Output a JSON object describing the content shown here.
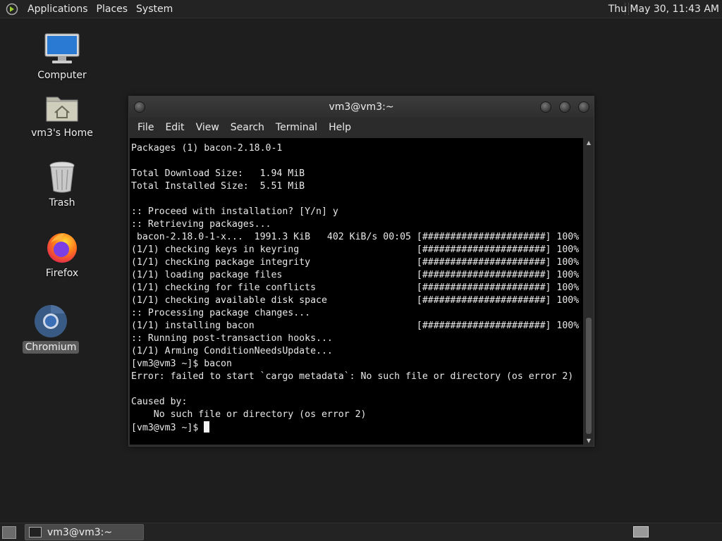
{
  "top_panel": {
    "menus": [
      "Applications",
      "Places",
      "System"
    ],
    "clock": "Thu May 30, 11:43 AM"
  },
  "desktop": {
    "icons": [
      {
        "label": "Computer",
        "icon": "computer-icon"
      },
      {
        "label": "vm3's Home",
        "icon": "home-folder-icon"
      },
      {
        "label": "Trash",
        "icon": "trash-icon"
      },
      {
        "label": "Firefox",
        "icon": "firefox-icon"
      },
      {
        "label": "Chromium",
        "icon": "chromium-icon"
      }
    ]
  },
  "terminal": {
    "title": "vm3@vm3:~",
    "menu": [
      "File",
      "Edit",
      "View",
      "Search",
      "Terminal",
      "Help"
    ],
    "lines": [
      "Packages (1) bacon-2.18.0-1",
      "",
      "Total Download Size:   1.94 MiB",
      "Total Installed Size:  5.51 MiB",
      "",
      ":: Proceed with installation? [Y/n] y",
      ":: Retrieving packages...",
      " bacon-2.18.0-1-x...  1991.3 KiB   402 KiB/s 00:05 [######################] 100%",
      "(1/1) checking keys in keyring                     [######################] 100%",
      "(1/1) checking package integrity                   [######################] 100%",
      "(1/1) loading package files                        [######################] 100%",
      "(1/1) checking for file conflicts                  [######################] 100%",
      "(1/1) checking available disk space                [######################] 100%",
      ":: Processing package changes...",
      "(1/1) installing bacon                             [######################] 100%",
      ":: Running post-transaction hooks...",
      "(1/1) Arming ConditionNeedsUpdate...",
      "[vm3@vm3 ~]$ bacon",
      "Error: failed to start `cargo metadata`: No such file or directory (os error 2)",
      "",
      "Caused by:",
      "    No such file or directory (os error 2)"
    ],
    "prompt": "[vm3@vm3 ~]$ "
  },
  "taskbar": {
    "window_label": "vm3@vm3:~"
  }
}
